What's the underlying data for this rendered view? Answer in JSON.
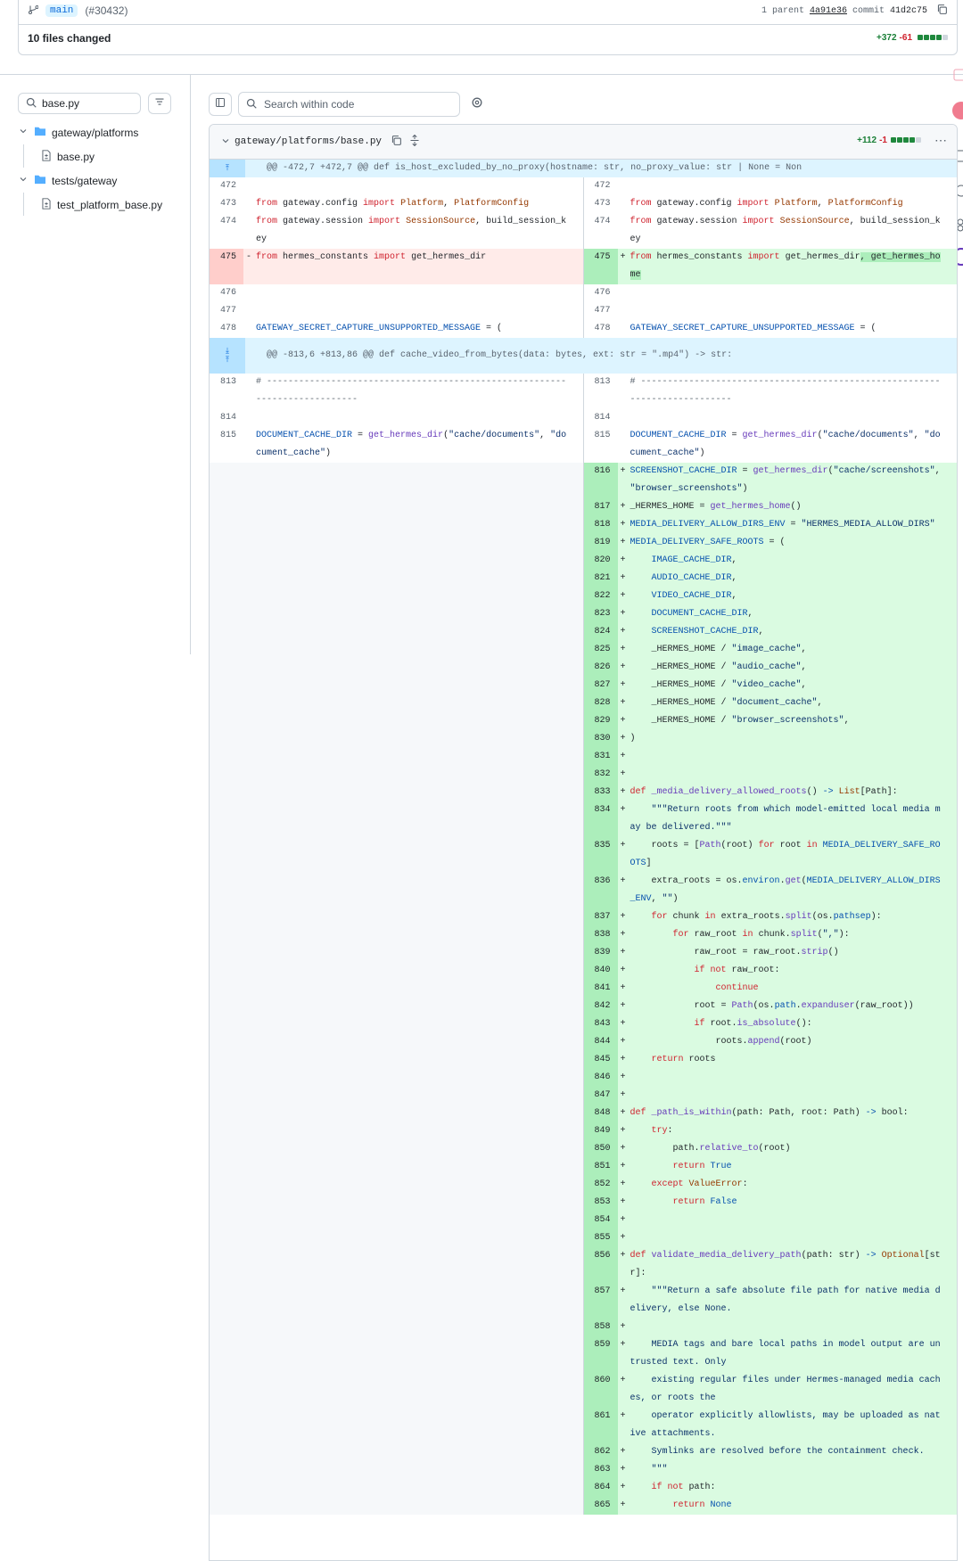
{
  "top": {
    "branch": "main",
    "pr_number": "(#30432)",
    "parents_label": "1 parent",
    "parent_sha": "4a91e36",
    "commit_label": "commit",
    "commit_sha": "41d2c75",
    "files_changed": "10 files changed",
    "additions": "+372",
    "deletions": "-61"
  },
  "sidebar": {
    "filter_value": "base.py",
    "tree": [
      {
        "type": "folder",
        "label": "gateway/platforms"
      },
      {
        "type": "file",
        "label": "base.py"
      },
      {
        "type": "folder",
        "label": "tests/gateway"
      },
      {
        "type": "file",
        "label": "test_platform_base.py"
      }
    ]
  },
  "toolbar": {
    "search_placeholder": "Search within code"
  },
  "file": {
    "path": "gateway/platforms/base.py",
    "additions": "+112",
    "deletions": "-1"
  },
  "hunks": [
    "@@ -472,7 +472,7 @@ def is_host_excluded_by_no_proxy(hostname: str, no_proxy_value: str | None = Non",
    "@@ -813,6 +813,86 @@ def cache_video_from_bytes(data: bytes, ext: str = \".mp4\") -> str:"
  ],
  "colors": {
    "addition": "#1a7f37",
    "deletion": "#cf222e",
    "add_bg": "#dafbe1",
    "del_bg": "#ffebe9",
    "hunk_bg": "#ddf4ff"
  }
}
